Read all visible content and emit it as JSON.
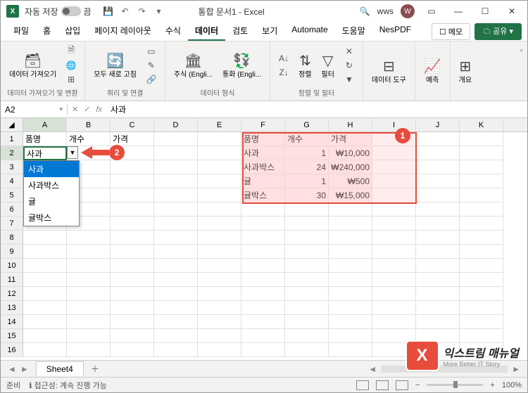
{
  "titlebar": {
    "autosave_label": "자동 저장",
    "autosave_state": "끔",
    "doc_title": "통합 문서1 - Excel",
    "search_placeholder": "",
    "user_short": "wws",
    "user_initial": "W"
  },
  "menubar": {
    "items": [
      "파일",
      "홈",
      "삽입",
      "페이지 레이아웃",
      "수식",
      "데이터",
      "검토",
      "보기",
      "Automate",
      "도움말",
      "NesPDF"
    ],
    "active_index": 5,
    "memo_label": "메모",
    "share_label": "공유"
  },
  "ribbon": {
    "groups": {
      "g0": {
        "label": "데이터 가져오기 및 변환",
        "btn_import": "데이터\n가져오기"
      },
      "g1": {
        "label": "쿼리 및 연결",
        "btn_refresh": "모두 새로\n고침"
      },
      "g2": {
        "label": "데이터 형식",
        "btn_stocks": "주식 (Engli...",
        "btn_currency": "통화 (Engli..."
      },
      "g3": {
        "label": "정렬 및 필터",
        "btn_sort": "정렬",
        "btn_filter": "필터"
      },
      "g4": {
        "btn_tools": "데이터\n도구"
      },
      "g5": {
        "btn_forecast": "예측"
      },
      "g6": {
        "btn_outline": "개요"
      }
    }
  },
  "formula": {
    "name_box": "A2",
    "value": "사과"
  },
  "columns": [
    "A",
    "B",
    "C",
    "D",
    "E",
    "F",
    "G",
    "H",
    "I",
    "J",
    "K"
  ],
  "rows_count": 16,
  "grid": {
    "a1": "품명",
    "b1": "개수",
    "c1": "가격",
    "a2": "사과",
    "f1": "품명",
    "g1": "개수",
    "h1": "가격",
    "f2": "사과",
    "g2": "1",
    "h2": "₩10,000",
    "f3": "사과박스",
    "g3": "24",
    "h3": "₩240,000",
    "f4": "귤",
    "g4": "1",
    "h4": "₩500",
    "f5": "귤박스",
    "g5": "30",
    "h5": "₩15,000"
  },
  "dropdown": {
    "items": [
      "사과",
      "사과박스",
      "귤",
      "귤박스"
    ],
    "selected_index": 0
  },
  "markers": {
    "m1": "1",
    "m2": "2"
  },
  "sheets": {
    "active": "Sheet4"
  },
  "statusbar": {
    "ready": "준비",
    "access": "접근성: 계속 진행 가능",
    "zoom": "100%"
  },
  "watermark": {
    "icon": "X",
    "main": "익스트림 매뉴얼",
    "sub": "More Better IT Story"
  },
  "chart_data": {
    "type": "table",
    "title": "",
    "columns": [
      "품명",
      "개수",
      "가격"
    ],
    "rows": [
      [
        "사과",
        1,
        10000
      ],
      [
        "사과박스",
        24,
        240000
      ],
      [
        "귤",
        1,
        500
      ],
      [
        "귤박스",
        30,
        15000
      ]
    ]
  }
}
